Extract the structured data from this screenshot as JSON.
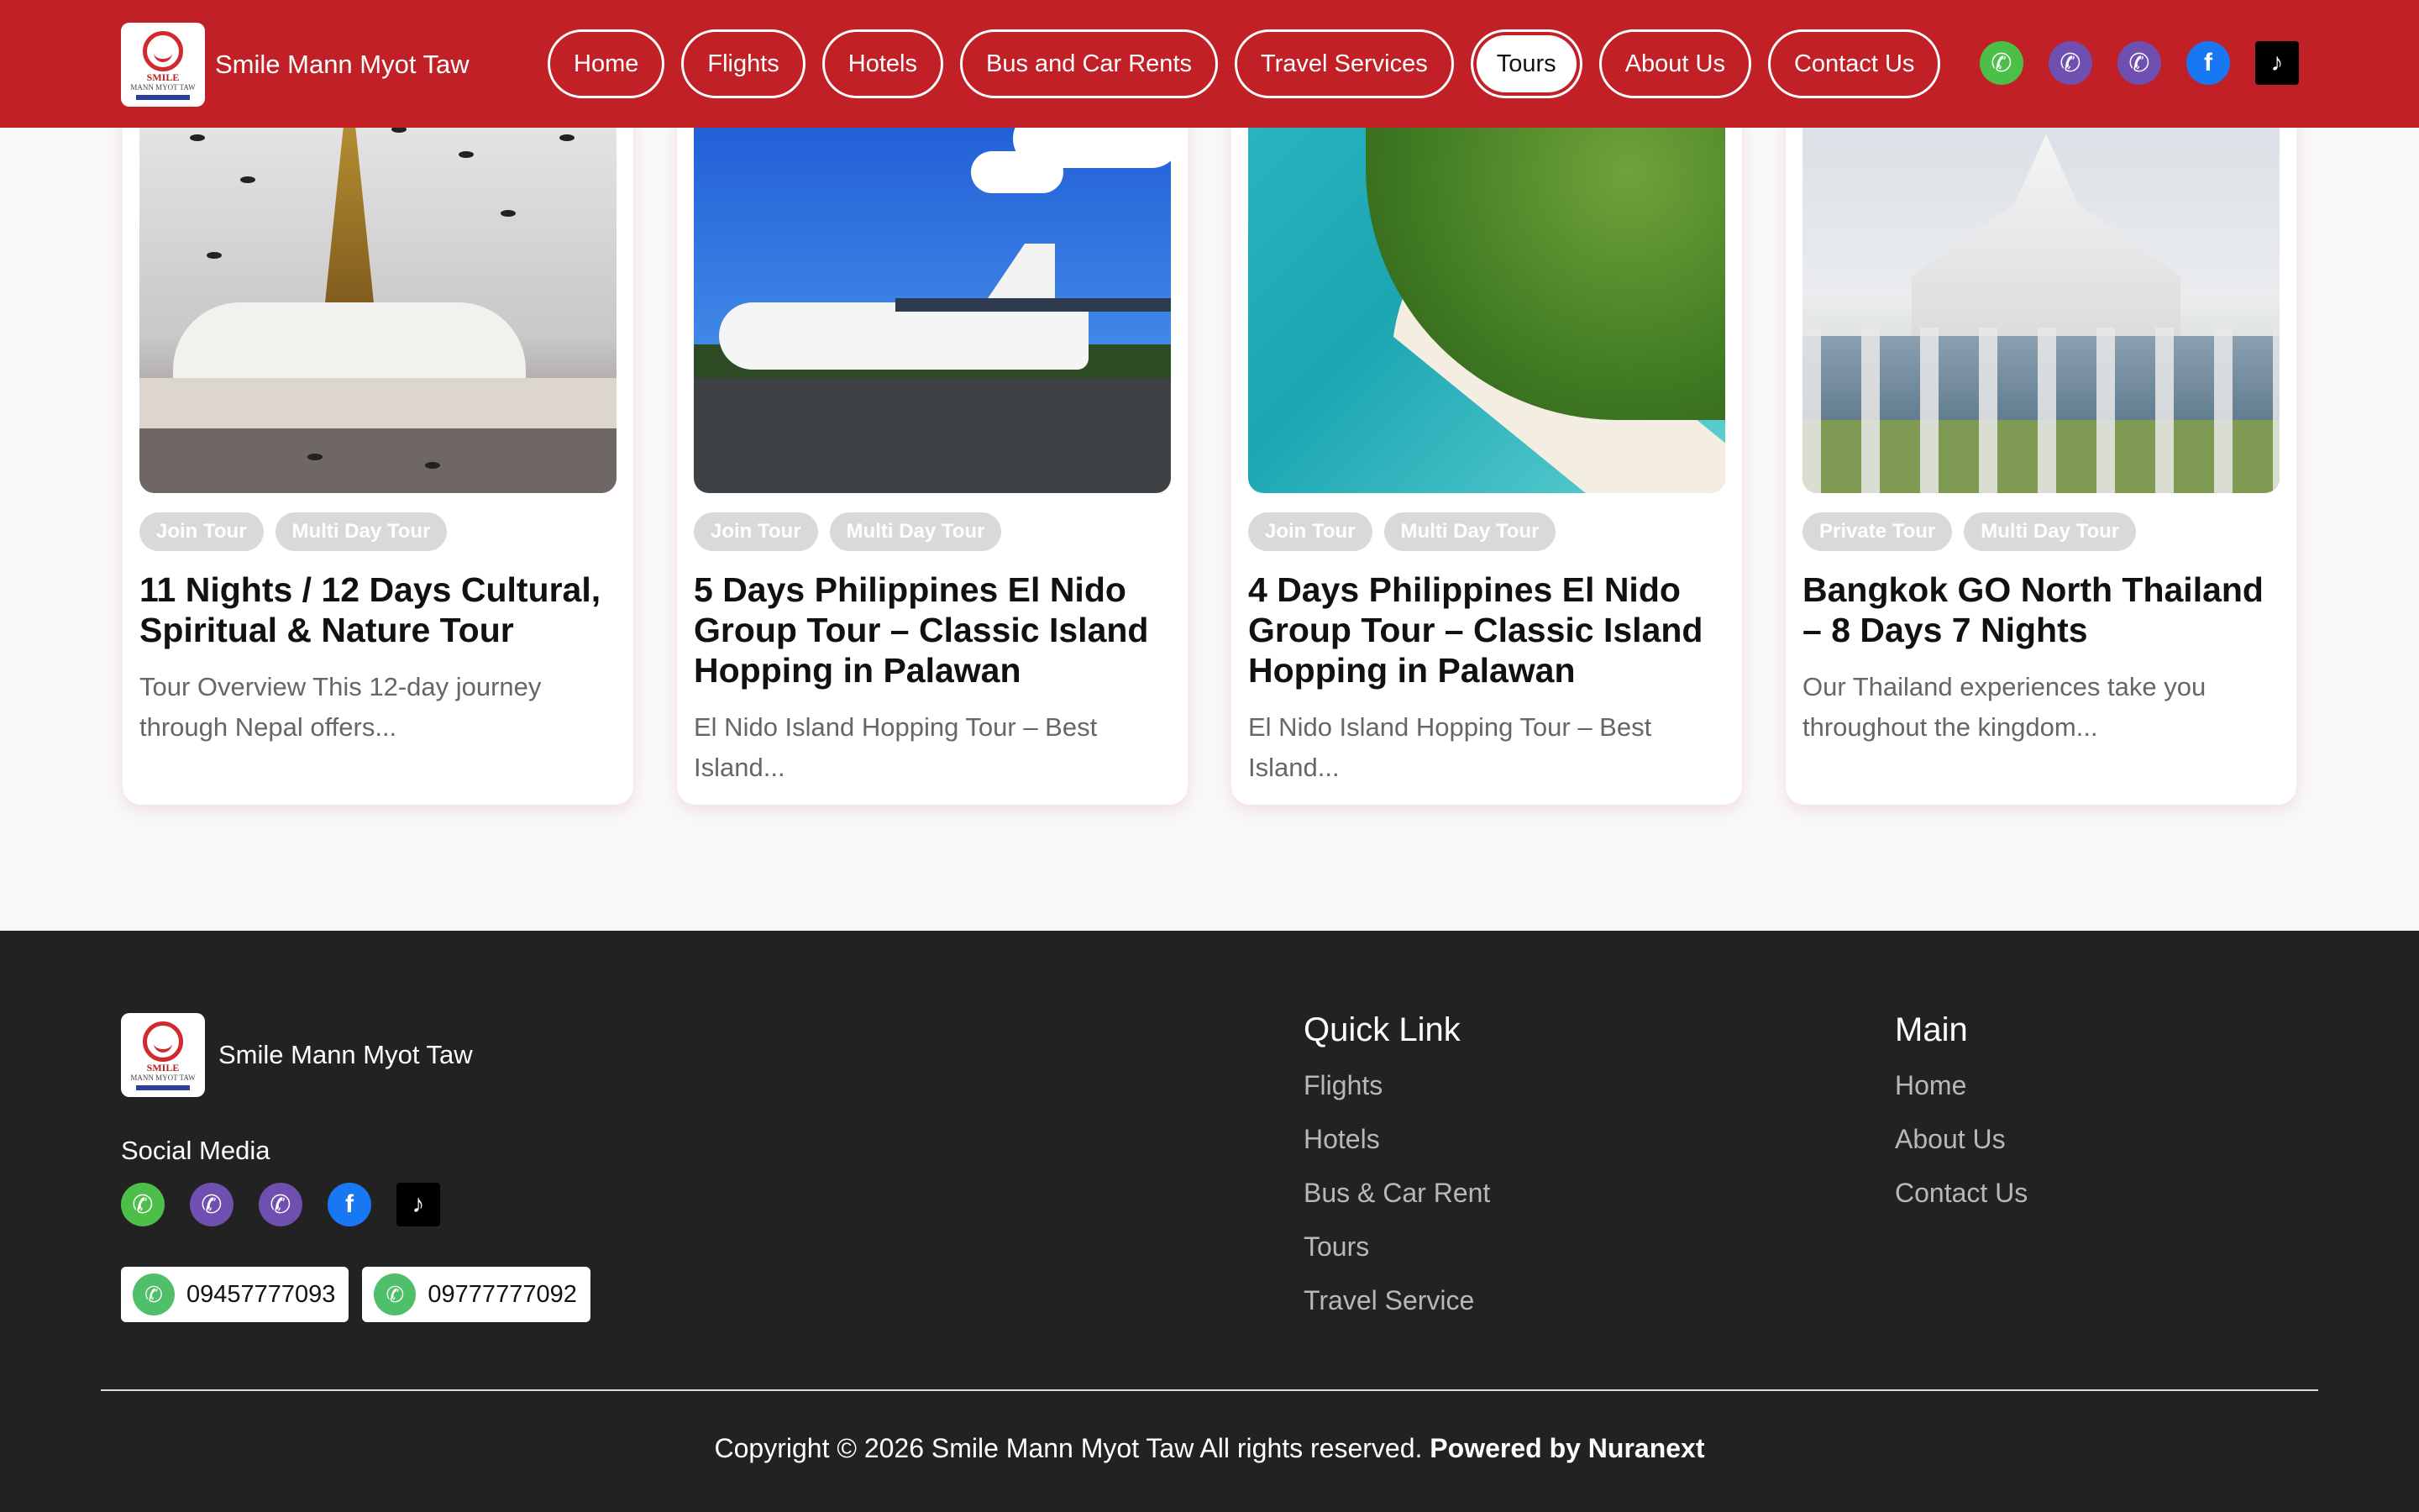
{
  "header": {
    "brand_name": "Smile Mann Myot Taw",
    "logo_text": "SMILE",
    "logo_subtext": "MANN MYOT TAW",
    "nav": [
      {
        "label": "Home"
      },
      {
        "label": "Flights"
      },
      {
        "label": "Hotels"
      },
      {
        "label": "Bus and Car Rents"
      },
      {
        "label": "Travel Services"
      },
      {
        "label": "Tours",
        "active": true
      },
      {
        "label": "About Us"
      },
      {
        "label": "Contact Us"
      }
    ],
    "social_icons": [
      "phone-icon",
      "viber-icon",
      "viber-icon",
      "facebook-icon",
      "tiktok-icon"
    ]
  },
  "tours": [
    {
      "tags": [
        "Join Tour",
        "Multi Day Tour"
      ],
      "title": "11 Nights / 12 Days Cultural, Spiritual & Nature Tour",
      "desc": "Tour Overview This 12-day journey through Nepal offers..."
    },
    {
      "tags": [
        "Join Tour",
        "Multi Day Tour"
      ],
      "title": "5 Days Philippines El Nido Group Tour – Classic Island Hopping in Palawan",
      "desc": "El Nido Island Hopping Tour – Best Island..."
    },
    {
      "tags": [
        "Join Tour",
        "Multi Day Tour"
      ],
      "title": "4 Days Philippines El Nido Group Tour – Classic Island Hopping in Palawan",
      "desc": "El Nido Island Hopping Tour – Best Island..."
    },
    {
      "tags": [
        "Private Tour",
        "Multi Day Tour"
      ],
      "title": "Bangkok GO North Thailand – 8 Days 7 Nights",
      "desc": "Our Thailand experiences take you throughout the kingdom..."
    }
  ],
  "footer": {
    "brand_name": "Smile Mann Myot Taw",
    "social_title": "Social Media",
    "phones": [
      "09457777093",
      "09777777092"
    ],
    "quick_link": {
      "title": "Quick Link",
      "items": [
        "Flights",
        "Hotels",
        "Bus & Car Rent",
        "Tours",
        "Travel Service"
      ]
    },
    "main": {
      "title": "Main",
      "items": [
        "Home",
        "About Us",
        "Contact Us"
      ]
    },
    "copyright": "Copyright © 2026 Smile Mann Myot Taw All rights reserved.",
    "powered_by": "Powered by Nuranext"
  },
  "colors": {
    "header_bg": "#c02026",
    "footer_bg": "#222222",
    "phone_green": "#4cbf49",
    "viber_purple": "#6f4fb0",
    "facebook_blue": "#1877f2"
  }
}
